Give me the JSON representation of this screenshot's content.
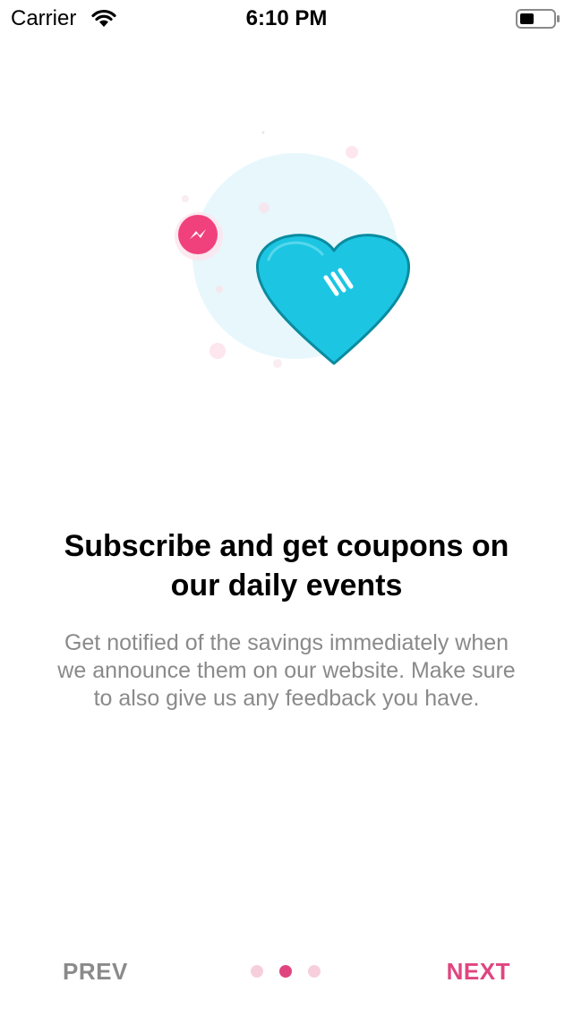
{
  "status_bar": {
    "carrier": "Carrier",
    "time": "6:10 PM",
    "wifi_icon": "wifi-icon",
    "battery_icon": "battery-icon"
  },
  "illustration": {
    "icons": [
      "heart-icon",
      "messenger-icon"
    ],
    "colors": {
      "heart": "#1cc6e3",
      "heart_outline": "#0a8ba0",
      "backdrop": "#e6f7fb",
      "badge": "#f0417d"
    }
  },
  "content": {
    "title": "Subscribe and get coupons on our daily events",
    "description": "Get notified of the savings immediately when we announce them on our website. Make sure to also give us any feedback you have."
  },
  "navigation": {
    "prev_label": "PREV",
    "next_label": "NEXT",
    "page_count": 3,
    "current_page": 2,
    "colors": {
      "accent": "#e0457f",
      "inactive_dot": "#f7cfdc",
      "muted_text": "#8a8a8a"
    }
  }
}
